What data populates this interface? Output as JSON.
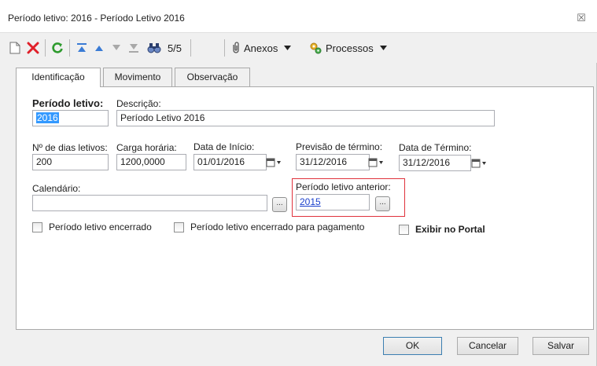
{
  "window": {
    "title": "Período letivo: 2016 - Período Letivo 2016",
    "close_glyph": "☒"
  },
  "toolbar": {
    "record_counter": "5/5",
    "attachments_label": "Anexos",
    "processes_label": "Processos",
    "icons": [
      "new-icon",
      "delete-icon",
      "refresh-icon",
      "first-record-icon",
      "previous-record-icon",
      "next-record-icon",
      "last-record-icon",
      "search-icon",
      "attachment-icon",
      "processes-icon"
    ]
  },
  "tabs": [
    {
      "label": "Identificação",
      "active": true
    },
    {
      "label": "Movimento",
      "active": false
    },
    {
      "label": "Observação",
      "active": false
    }
  ],
  "form": {
    "periodo_label": "Período letivo:",
    "periodo_value": "2016",
    "descricao_label": "Descrição:",
    "descricao_value": "Período Letivo 2016",
    "dias_label": "Nº de dias letivos:",
    "dias_value": "200",
    "carga_label": "Carga horária:",
    "carga_value": "1200,0000",
    "inicio_label": "Data de Início:",
    "inicio_value": "01/01/2016",
    "previsao_label": "Previsão de término:",
    "previsao_value": "31/12/2016",
    "termino_label": "Data de Término:",
    "termino_value": "31/12/2016",
    "calendario_label": "Calendário:",
    "calendario_value": "",
    "anterior_label": "Período letivo anterior:",
    "anterior_value": "2015",
    "ellipsis": "...",
    "chk_encerrado_label": "Período letivo encerrado",
    "chk_pagamento_label": "Período letivo encerrado para pagamento",
    "chk_portal_label": "Exibir no Portal"
  },
  "footer": {
    "ok_label": "OK",
    "cancel_label": "Cancelar",
    "save_label": "Salvar"
  },
  "colors": {
    "highlight_border": "#e0323c",
    "selection": "#3399ff",
    "link": "#1a3fcc"
  }
}
